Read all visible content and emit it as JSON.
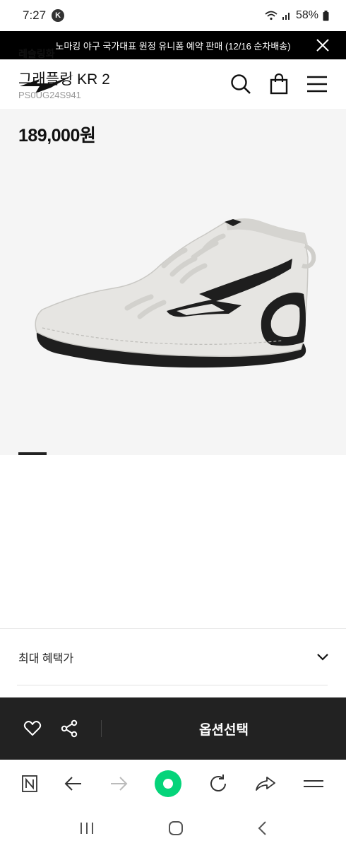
{
  "status_bar": {
    "time": "7:27",
    "app_badge": "K",
    "battery": "58%"
  },
  "promo_banner": {
    "text": "노마킹 야구 국가대표 원정 유니폼 예약 판매 (12/16 순차배송)"
  },
  "product": {
    "category": "레슬링화",
    "name": "그래플링 KR 2",
    "code": "PS0UG24S941",
    "price": "189,000원"
  },
  "benefit": {
    "label": "최대 혜택가"
  },
  "action_bar": {
    "option_label": "옵션선택"
  },
  "colors": {
    "banner_bg": "#000000",
    "action_bar_bg": "#222222",
    "hero_bg": "#f5f5f5",
    "browser_home_accent": "#05d47a"
  }
}
